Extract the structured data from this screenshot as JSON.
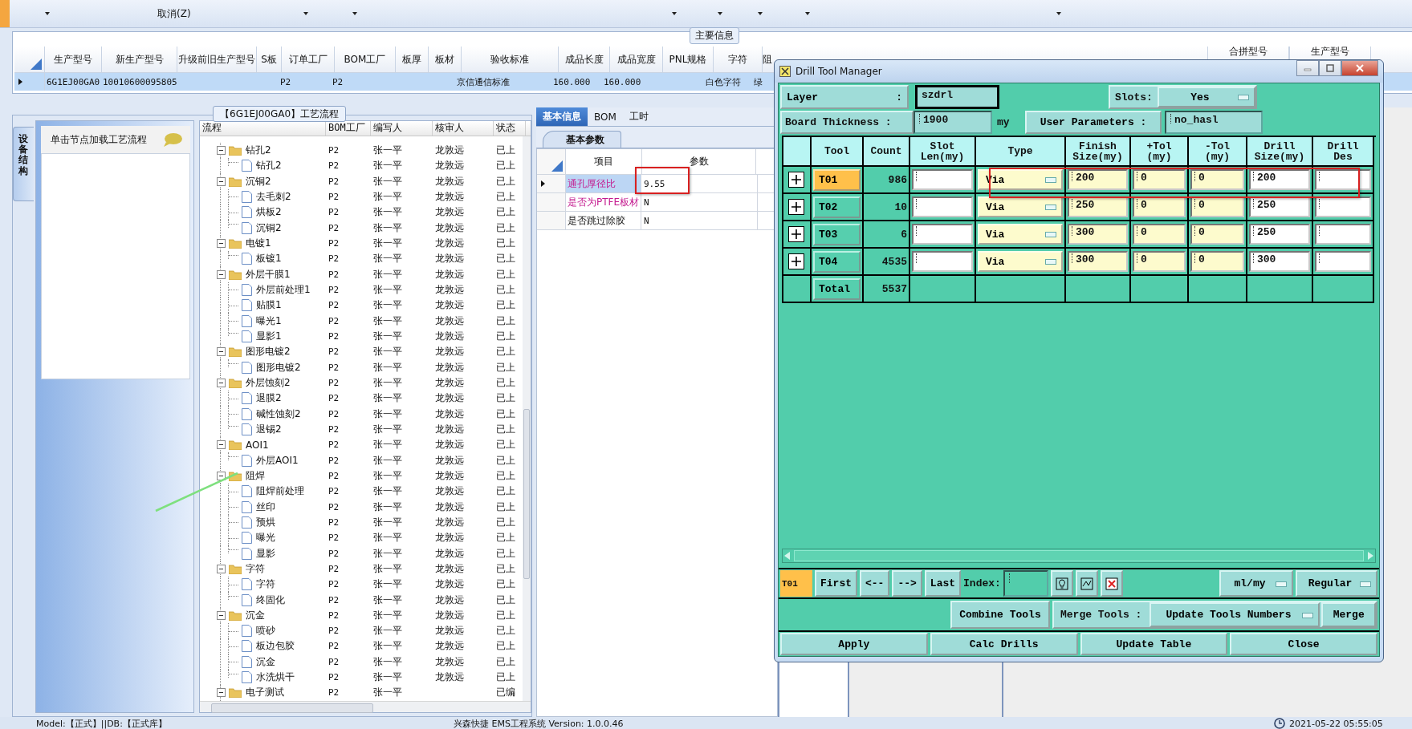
{
  "toolbar": {
    "cancel_label": "取消(Z)"
  },
  "main_info": {
    "title": "主要信息",
    "columns": [
      "生产型号",
      "新生产型号",
      "升级前旧生产型号",
      "S板",
      "订单工厂",
      "BOM工厂",
      "板厚",
      "板材",
      "验收标准",
      "成品长度",
      "成品宽度",
      "PNL规格",
      "字符",
      "阻"
    ],
    "right_columns": [
      "合拼型号",
      "生产型号"
    ],
    "rows": [
      [
        "6G1EJ00GA0",
        "10010600095805",
        "",
        "",
        "P2",
        "P2",
        "",
        "",
        "京信通信标准",
        "160.000",
        "160.000",
        "",
        "白色字符",
        "绿"
      ]
    ]
  },
  "process_panel": {
    "title": "【6G1EJ00GA0】工艺流程",
    "side_tab": "设备结构",
    "hint": "单击节点加载工艺流程",
    "columns": [
      "流程",
      "BOM工厂",
      "编写人",
      "核审人",
      "状态"
    ],
    "nodes": [
      {
        "label": "钻孔2",
        "bom": "P2",
        "writer": "张一平",
        "reviewer": "龙敦远",
        "status": "已上",
        "expanded": true,
        "children": [
          {
            "label": "钻孔2",
            "bom": "P2",
            "writer": "张一平",
            "reviewer": "龙敦远",
            "status": "已上"
          }
        ]
      },
      {
        "label": "沉铜2",
        "bom": "P2",
        "writer": "张一平",
        "reviewer": "龙敦远",
        "status": "已上",
        "expanded": true,
        "children": [
          {
            "label": "去毛刺2",
            "bom": "P2",
            "writer": "张一平",
            "reviewer": "龙敦远",
            "status": "已上"
          },
          {
            "label": "烘板2",
            "bom": "P2",
            "writer": "张一平",
            "reviewer": "龙敦远",
            "status": "已上"
          },
          {
            "label": "沉铜2",
            "bom": "P2",
            "writer": "张一平",
            "reviewer": "龙敦远",
            "status": "已上"
          }
        ]
      },
      {
        "label": "电镀1",
        "bom": "P2",
        "writer": "张一平",
        "reviewer": "龙敦远",
        "status": "已上",
        "expanded": true,
        "children": [
          {
            "label": "板镀1",
            "bom": "P2",
            "writer": "张一平",
            "reviewer": "龙敦远",
            "status": "已上"
          }
        ]
      },
      {
        "label": "外层干膜1",
        "bom": "P2",
        "writer": "张一平",
        "reviewer": "龙敦远",
        "status": "已上",
        "expanded": true,
        "children": [
          {
            "label": "外层前处理1",
            "bom": "P2",
            "writer": "张一平",
            "reviewer": "龙敦远",
            "status": "已上"
          },
          {
            "label": "贴膜1",
            "bom": "P2",
            "writer": "张一平",
            "reviewer": "龙敦远",
            "status": "已上"
          },
          {
            "label": "曝光1",
            "bom": "P2",
            "writer": "张一平",
            "reviewer": "龙敦远",
            "status": "已上"
          },
          {
            "label": "显影1",
            "bom": "P2",
            "writer": "张一平",
            "reviewer": "龙敦远",
            "status": "已上"
          }
        ]
      },
      {
        "label": "图形电镀2",
        "bom": "P2",
        "writer": "张一平",
        "reviewer": "龙敦远",
        "status": "已上",
        "expanded": true,
        "children": [
          {
            "label": "图形电镀2",
            "bom": "P2",
            "writer": "张一平",
            "reviewer": "龙敦远",
            "status": "已上"
          }
        ]
      },
      {
        "label": "外层蚀刻2",
        "bom": "P2",
        "writer": "张一平",
        "reviewer": "龙敦远",
        "status": "已上",
        "expanded": true,
        "children": [
          {
            "label": "退膜2",
            "bom": "P2",
            "writer": "张一平",
            "reviewer": "龙敦远",
            "status": "已上"
          },
          {
            "label": "碱性蚀刻2",
            "bom": "P2",
            "writer": "张一平",
            "reviewer": "龙敦远",
            "status": "已上"
          },
          {
            "label": "退锡2",
            "bom": "P2",
            "writer": "张一平",
            "reviewer": "龙敦远",
            "status": "已上"
          }
        ]
      },
      {
        "label": "AOI1",
        "bom": "P2",
        "writer": "张一平",
        "reviewer": "龙敦远",
        "status": "已上",
        "expanded": true,
        "children": [
          {
            "label": "外层AOI1",
            "bom": "P2",
            "writer": "张一平",
            "reviewer": "龙敦远",
            "status": "已上"
          }
        ]
      },
      {
        "label": "阻焊",
        "bom": "P2",
        "writer": "张一平",
        "reviewer": "龙敦远",
        "status": "已上",
        "expanded": true,
        "children": [
          {
            "label": "阻焊前处理",
            "bom": "P2",
            "writer": "张一平",
            "reviewer": "龙敦远",
            "status": "已上"
          },
          {
            "label": "丝印",
            "bom": "P2",
            "writer": "张一平",
            "reviewer": "龙敦远",
            "status": "已上"
          },
          {
            "label": "预烘",
            "bom": "P2",
            "writer": "张一平",
            "reviewer": "龙敦远",
            "status": "已上"
          },
          {
            "label": "曝光",
            "bom": "P2",
            "writer": "张一平",
            "reviewer": "龙敦远",
            "status": "已上"
          },
          {
            "label": "显影",
            "bom": "P2",
            "writer": "张一平",
            "reviewer": "龙敦远",
            "status": "已上"
          }
        ]
      },
      {
        "label": "字符",
        "bom": "P2",
        "writer": "张一平",
        "reviewer": "龙敦远",
        "status": "已上",
        "expanded": true,
        "children": [
          {
            "label": "字符",
            "bom": "P2",
            "writer": "张一平",
            "reviewer": "龙敦远",
            "status": "已上"
          },
          {
            "label": "终固化",
            "bom": "P2",
            "writer": "张一平",
            "reviewer": "龙敦远",
            "status": "已上"
          }
        ]
      },
      {
        "label": "沉金",
        "bom": "P2",
        "writer": "张一平",
        "reviewer": "龙敦远",
        "status": "已上",
        "expanded": true,
        "children": [
          {
            "label": "喷砂",
            "bom": "P2",
            "writer": "张一平",
            "reviewer": "龙敦远",
            "status": "已上"
          },
          {
            "label": "板边包胶",
            "bom": "P2",
            "writer": "张一平",
            "reviewer": "龙敦远",
            "status": "已上"
          },
          {
            "label": "沉金",
            "bom": "P2",
            "writer": "张一平",
            "reviewer": "龙敦远",
            "status": "已上"
          },
          {
            "label": "水洗烘干",
            "bom": "P2",
            "writer": "张一平",
            "reviewer": "龙敦远",
            "status": "已上"
          }
        ]
      },
      {
        "label": "电子测试",
        "bom": "P2",
        "writer": "张一平",
        "status": "已编",
        "expanded": true
      }
    ]
  },
  "detail_panel": {
    "tabs": [
      {
        "label": "基本信息",
        "selected": true
      },
      {
        "label": "BOM",
        "selected": false
      },
      {
        "label": "工时",
        "selected": false
      }
    ],
    "subtab": "基本参数",
    "columns": [
      "项目",
      "参数"
    ],
    "rows": [
      {
        "item": "通孔厚径比",
        "value": "9.55",
        "highlighted": true,
        "current": true
      },
      {
        "item": "是否为PTFE板材",
        "value": "N",
        "highlighted": true,
        "current": false
      },
      {
        "item": "是否跳过除胶",
        "value": "N",
        "highlighted": false,
        "current": false
      }
    ]
  },
  "drill_dialog": {
    "title": "Drill Tool Manager",
    "layer_label": "Layer",
    "layer_colon": ":",
    "layer_value": "szdrl",
    "slots_label": "Slots:",
    "slots_value": "Yes",
    "board_thickness_label": "Board Thickness :",
    "board_thickness_value": "1900",
    "board_thickness_unit": "my",
    "user_parameters_label": "User Parameters :",
    "user_parameters_value": "no_hasl",
    "columns": [
      "Tool",
      "Count",
      "Slot Len(my)",
      "Type",
      "Finish Size(my)",
      "+Tol (my)",
      "-Tol (my)",
      "Drill Size(my)",
      "Drill Des"
    ],
    "rows": [
      {
        "tool": "T01",
        "selected": true,
        "count": "986",
        "type": "Via",
        "finish": "200",
        "plus_tol": "0",
        "minus_tol": "0",
        "drill_size": "200"
      },
      {
        "tool": "T02",
        "selected": false,
        "count": "10",
        "type": "Via",
        "finish": "250",
        "plus_tol": "0",
        "minus_tol": "0",
        "drill_size": "250"
      },
      {
        "tool": "T03",
        "selected": false,
        "count": "6",
        "type": "Via",
        "finish": "300",
        "plus_tol": "0",
        "minus_tol": "0",
        "drill_size": "250"
      },
      {
        "tool": "T04",
        "selected": false,
        "count": "4535",
        "type": "Via",
        "finish": "300",
        "plus_tol": "0",
        "minus_tol": "0",
        "drill_size": "300"
      }
    ],
    "total": {
      "label": "Total",
      "count": "5537"
    },
    "current_tool": "T01",
    "nav_buttons": [
      "First",
      "<--",
      "-->",
      "Last"
    ],
    "index_label": "Index:",
    "units": "ml/my",
    "mode": "Regular",
    "combine_button": "Combine Tools",
    "merge_label": "Merge Tools :",
    "merge_option": "Update Tools Numbers",
    "merge_button": "Merge",
    "actions": [
      "Apply",
      "Calc Drills",
      "Update Table",
      "Close"
    ]
  },
  "status_bar": {
    "model": "Model:【正式】||DB:【正式库】",
    "app": "兴森快捷 EMS工程系统 Version: 1.0.0.46",
    "time": "2021-05-22 05:55:05"
  }
}
